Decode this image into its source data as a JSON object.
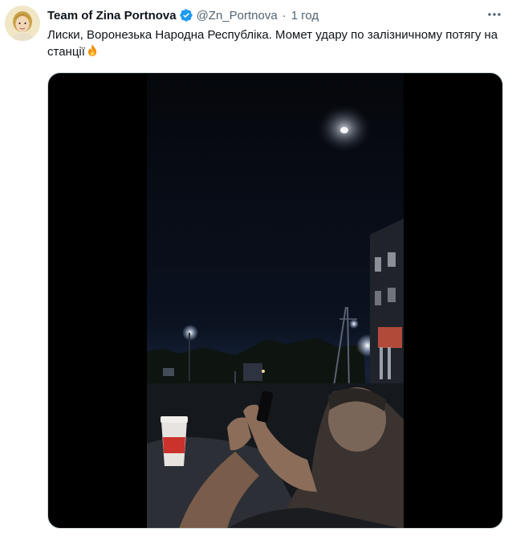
{
  "tweet": {
    "author": {
      "display_name": "Team of Zina Portnova",
      "handle": "@Zn_Portnova",
      "verified": true,
      "avatar_icon": "avatar-portrait"
    },
    "timestamp": "1 год",
    "separator": "·",
    "text": "Лиски, Воронезька Народна Республіка. Момет удару по залізничному потягу на станції",
    "emoji": "fire-emoji",
    "more_icon": "more-horizontal-icon",
    "media": {
      "type": "video",
      "aspect": "vertical"
    }
  },
  "colors": {
    "text_primary": "#0f1419",
    "text_secondary": "#536471",
    "verified_blue": "#1d9bf0",
    "media_background": "#000000"
  }
}
